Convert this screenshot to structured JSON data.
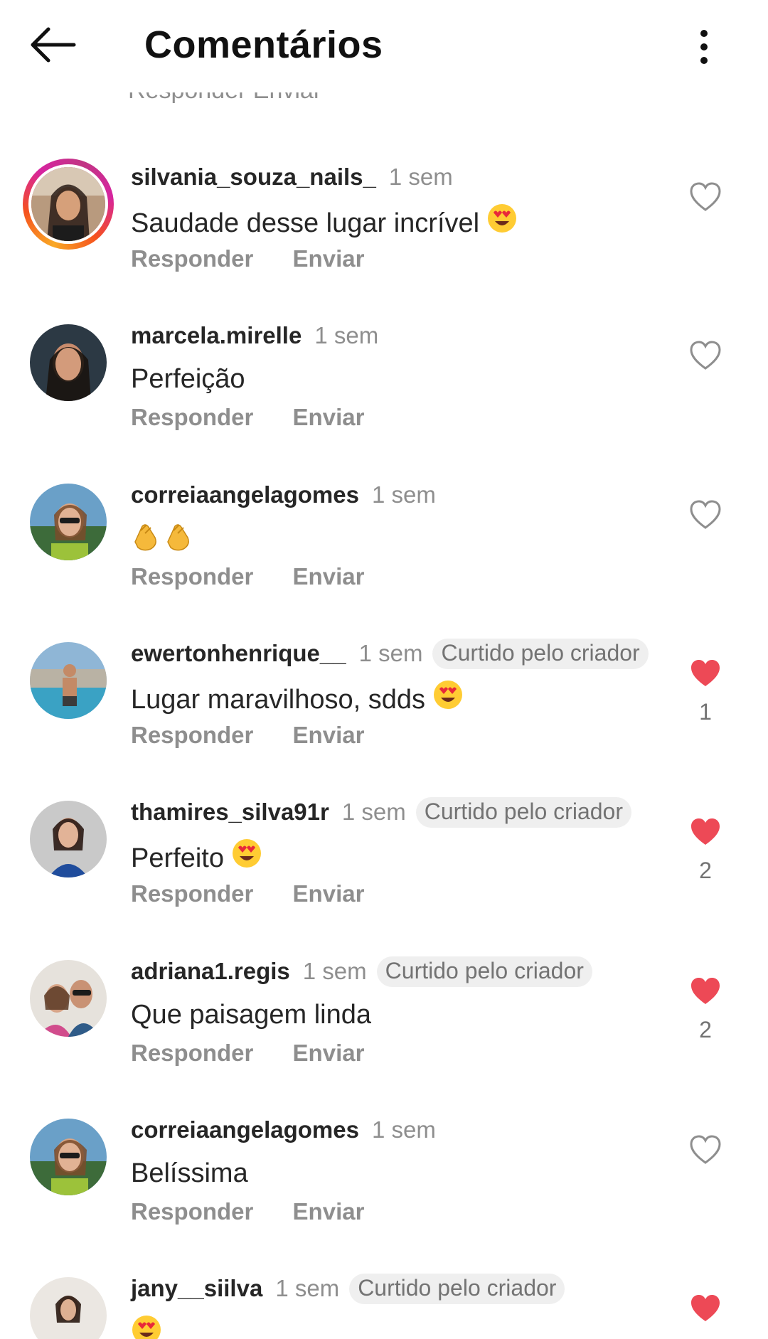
{
  "header": {
    "title": "Comentários",
    "back_icon": "arrow-left-icon",
    "menu_icon": "vertical-dots-icon",
    "cutoff_text": "Responder Enviar"
  },
  "colors": {
    "liked_heart": "#ed4956",
    "text_primary": "#262626",
    "text_secondary": "#8e8e8e",
    "badge_bg": "#efefef"
  },
  "comments": [
    {
      "username": "silvania_souza_nails_",
      "time": "1 sem",
      "text": "Saudade desse lugar incrível",
      "emoji": "heart-eyes",
      "liked_by_creator": "",
      "liked": false,
      "like_count": "",
      "reply_label": "Responder",
      "send_label": "Enviar",
      "story_ring": true
    },
    {
      "username": "marcela.mirelle",
      "time": "1 sem",
      "text": "Perfeição",
      "emoji": "",
      "liked_by_creator": "",
      "liked": false,
      "like_count": "",
      "reply_label": "Responder",
      "send_label": "Enviar",
      "story_ring": false
    },
    {
      "username": "correiaangelagomes",
      "time": "1 sem",
      "text": "",
      "emoji": "clapping-hands-x2",
      "liked_by_creator": "",
      "liked": false,
      "like_count": "",
      "reply_label": "Responder",
      "send_label": "Enviar",
      "story_ring": false
    },
    {
      "username": "ewertonhenrique__",
      "time": "1 sem",
      "text": "Lugar maravilhoso,  sdds",
      "emoji": "heart-eyes",
      "liked_by_creator": "Curtido pelo criador",
      "liked": true,
      "like_count": "1",
      "reply_label": "Responder",
      "send_label": "Enviar",
      "story_ring": false
    },
    {
      "username": "thamires_silva91r",
      "time": "1 sem",
      "text": "Perfeito",
      "emoji": "heart-eyes",
      "liked_by_creator": "Curtido pelo criador",
      "liked": true,
      "like_count": "2",
      "reply_label": "Responder",
      "send_label": "Enviar",
      "story_ring": false
    },
    {
      "username": "adriana1.regis",
      "time": "1 sem",
      "text": "Que paisagem linda",
      "emoji": "",
      "liked_by_creator": "Curtido pelo criador",
      "liked": true,
      "like_count": "2",
      "reply_label": "Responder",
      "send_label": "Enviar",
      "story_ring": false
    },
    {
      "username": "correiaangelagomes",
      "time": "1 sem",
      "text": "Belíssima",
      "emoji": "",
      "liked_by_creator": "",
      "liked": false,
      "like_count": "",
      "reply_label": "Responder",
      "send_label": "Enviar",
      "story_ring": false
    },
    {
      "username": "jany__siilva",
      "time": "1 sem",
      "text": "",
      "emoji": "heart-eyes",
      "liked_by_creator": "Curtido pelo criador",
      "liked": true,
      "like_count": "",
      "reply_label": "",
      "send_label": "",
      "story_ring": false
    }
  ]
}
